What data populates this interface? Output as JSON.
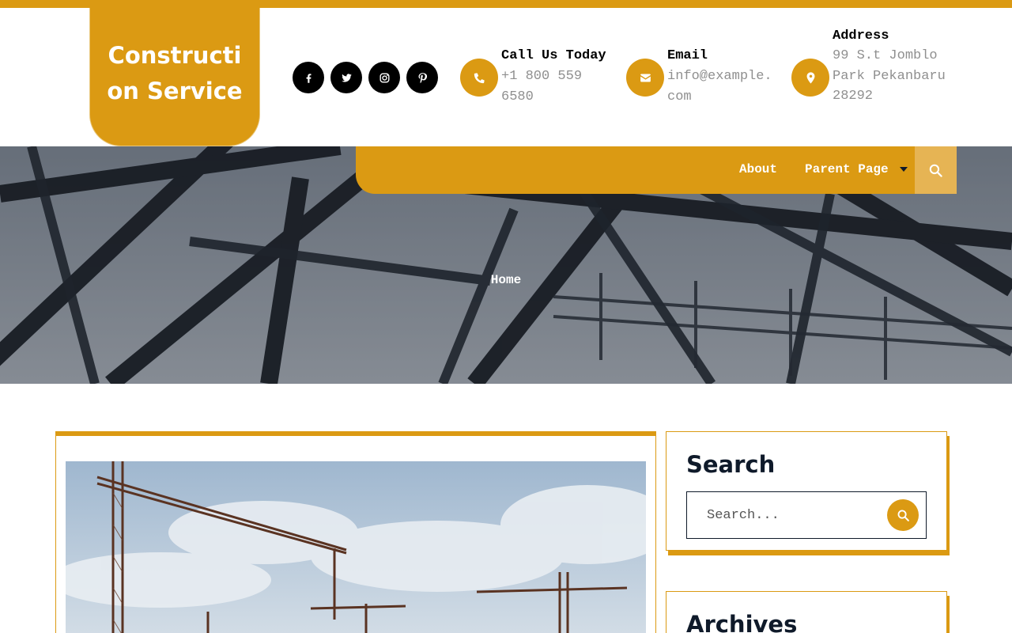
{
  "brand": {
    "logo_text": "Construction Service",
    "accent_color": "#db9a13"
  },
  "social": [
    {
      "icon": "facebook-icon"
    },
    {
      "icon": "twitter-icon"
    },
    {
      "icon": "instagram-icon"
    },
    {
      "icon": "pinterest-icon"
    }
  ],
  "contacts": {
    "phone": {
      "icon": "phone-icon",
      "title": "Call Us Today",
      "value": "+1 800 559 6580"
    },
    "email": {
      "icon": "envelope-icon",
      "title": "Email",
      "value": "info@example.com"
    },
    "address": {
      "icon": "map-marker-icon",
      "title": "Address",
      "value": "99 S.t Jomblo Park Pekanbaru 28292"
    }
  },
  "nav": {
    "items": [
      "About",
      "Parent Page"
    ],
    "search_icon": "search-icon"
  },
  "hero": {
    "breadcrumb": "Home"
  },
  "sidebar": {
    "search": {
      "title": "Search",
      "placeholder": "Search..."
    },
    "archives": {
      "title": "Archives"
    }
  }
}
